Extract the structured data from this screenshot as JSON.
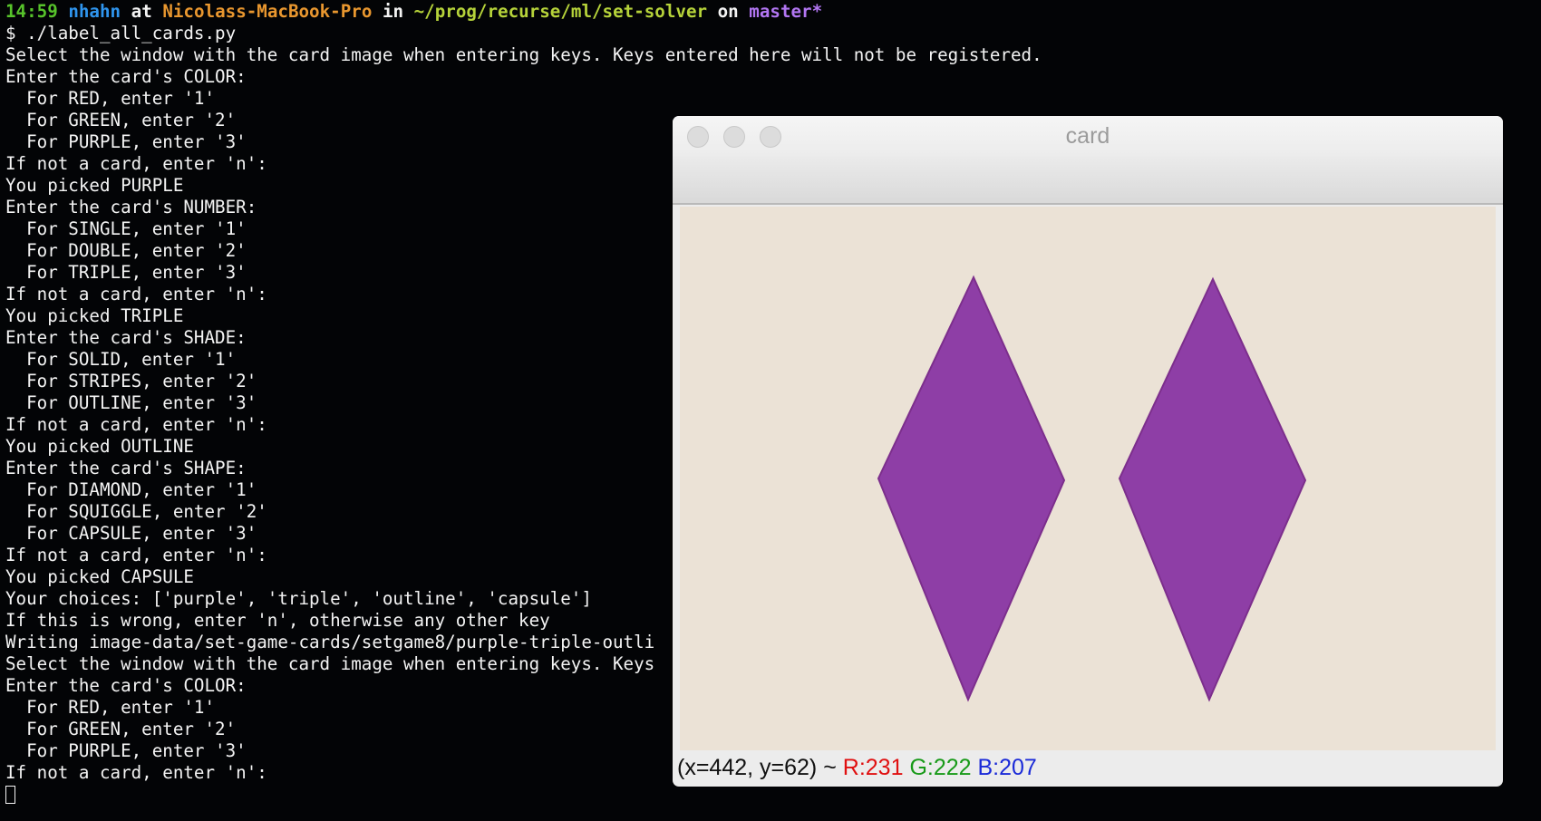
{
  "prompt": {
    "time": "14:59",
    "user": "nhahn",
    "at": "at",
    "host": "Nicolass-MacBook-Pro",
    "in": "in",
    "path": "~/prog/recurse/ml/set-solver",
    "on": "on",
    "branch": "master*"
  },
  "terminal_lines": [
    "$ ./label_all_cards.py",
    "Select the window with the card image when entering keys. Keys entered here will not be registered.",
    "Enter the card's COLOR:",
    "  For RED, enter '1'",
    "  For GREEN, enter '2'",
    "  For PURPLE, enter '3'",
    "If not a card, enter 'n':",
    "You picked PURPLE",
    "Enter the card's NUMBER:",
    "  For SINGLE, enter '1'",
    "  For DOUBLE, enter '2'",
    "  For TRIPLE, enter '3'",
    "If not a card, enter 'n':",
    "You picked TRIPLE",
    "Enter the card's SHADE:",
    "  For SOLID, enter '1'",
    "  For STRIPES, enter '2'",
    "  For OUTLINE, enter '3'",
    "If not a card, enter 'n':",
    "You picked OUTLINE",
    "Enter the card's SHAPE:",
    "  For DIAMOND, enter '1'",
    "  For SQUIGGLE, enter '2'",
    "  For CAPSULE, enter '3'",
    "If not a card, enter 'n':",
    "You picked CAPSULE",
    "Your choices: ['purple', 'triple', 'outline', 'capsule']",
    "If this is wrong, enter 'n', otherwise any other key",
    "Writing image-data/set-game-cards/setgame8/purple-triple-outli",
    "Select the window with the card image when entering keys. Keys",
    "Enter the card's COLOR:",
    "  For RED, enter '1'",
    "  For GREEN, enter '2'",
    "  For PURPLE, enter '3'",
    "If not a card, enter 'n':"
  ],
  "card_window": {
    "title": "card",
    "status": {
      "coords": "(x=442, y=62) ~ ",
      "r": "R:231",
      "g": "G:222",
      "b": "B:207"
    },
    "image_background": "#ebe2d6",
    "shape_color": "#8e3ea6",
    "shapes": [
      "diamond",
      "diamond"
    ]
  }
}
